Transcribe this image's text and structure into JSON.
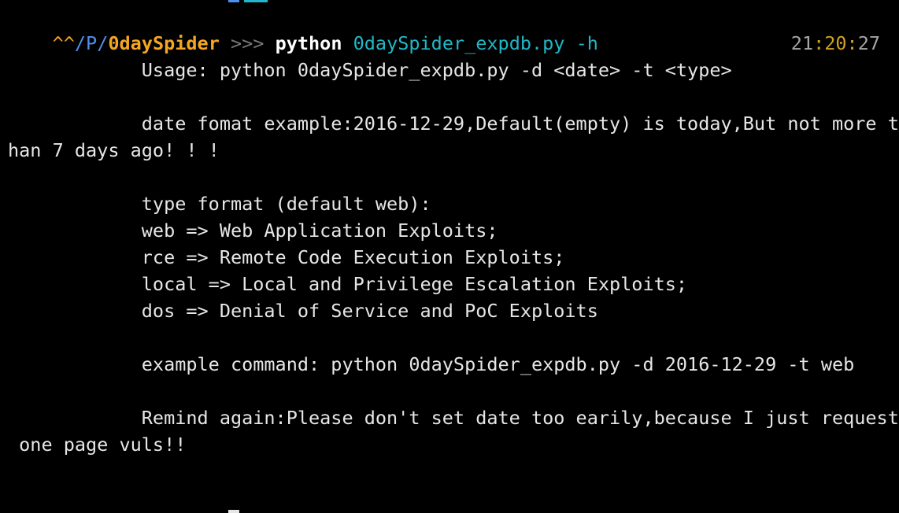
{
  "colors": {
    "background": "#000000",
    "text": "#e6e6e6",
    "prompt_user": "#f5a623",
    "prompt_path": "#4f8ff0",
    "prompt_dir": "#f5a623",
    "prompt_arrows": "#7a7a7a",
    "command_cmd": "#ffffff",
    "command_args": "#20b8c8",
    "time_digits": "#a6a6a6",
    "time_colon": "#d4a020"
  },
  "prompt": {
    "caret": "^^",
    "slash1": "/",
    "path_p": "P",
    "slash2": "/",
    "dir": "0daySpider",
    "arrows": " >>> ",
    "command": "python",
    "args": " 0daySpider_expdb.py -h"
  },
  "clock": {
    "hh": "21",
    "colon1": ":",
    "mm": "20",
    "colon2": ":",
    "ss": "27"
  },
  "output": [
    {
      "id": "usage",
      "text": "            Usage: python 0daySpider_expdb.py -d <date> -t <type>"
    },
    {
      "id": "date-format-1",
      "text": "            date fomat example:2016-12-29,Default(empty) is today,But not more t"
    },
    {
      "id": "date-format-2",
      "text": "han 7 days ago! ! !"
    },
    {
      "id": "type-format",
      "text": "            type format (default web):"
    },
    {
      "id": "type-web",
      "text": "            web => Web Application Exploits;"
    },
    {
      "id": "type-rce",
      "text": "            rce => Remote Code Execution Exploits;"
    },
    {
      "id": "type-local",
      "text": "            local => Local and Privilege Escalation Exploits;"
    },
    {
      "id": "type-dos",
      "text": "            dos => Denial of Service and PoC Exploits"
    },
    {
      "id": "example-command",
      "text": "            example command: python 0daySpider_expdb.py -d 2016-12-29 -t web"
    },
    {
      "id": "remind-1",
      "text": "            Remind again:Please don't set date too earily,because I just request"
    },
    {
      "id": "remind-2",
      "text": " one page vuls!!"
    }
  ]
}
